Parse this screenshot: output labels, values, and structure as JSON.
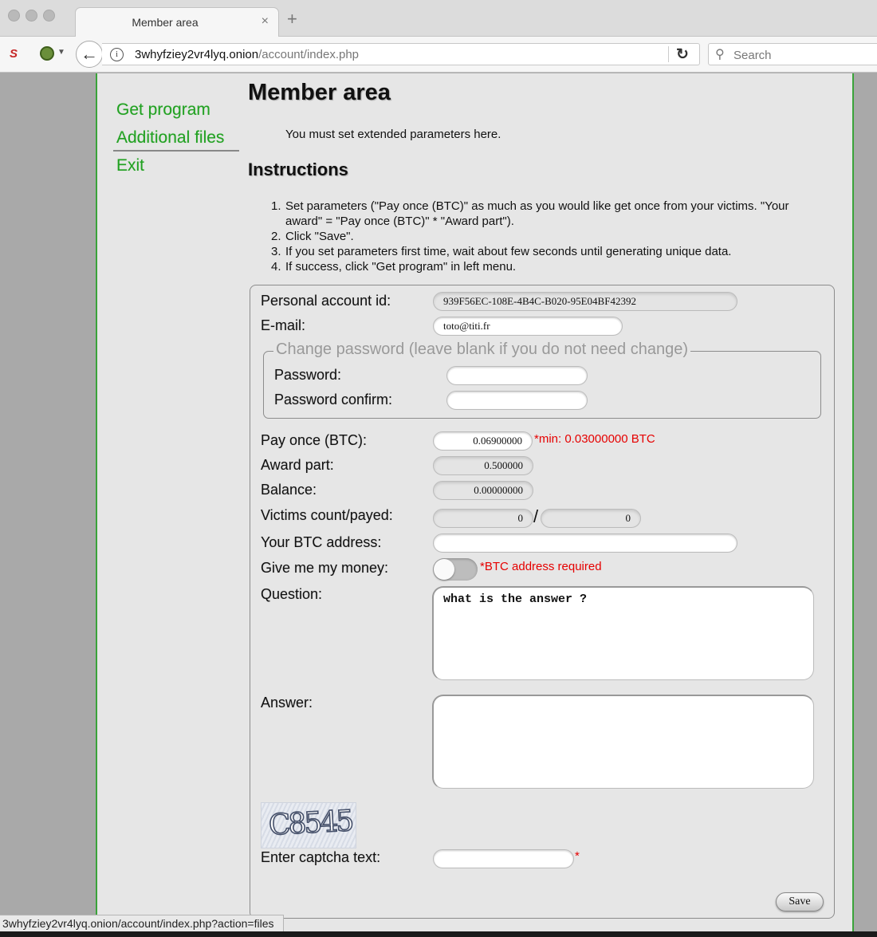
{
  "browser": {
    "tab_title": "Member area",
    "tab_close": "×",
    "new_tab": "+",
    "url_host": "3whyfziey2vr4lyq.onion",
    "url_path": "/account/index.php",
    "search_placeholder": "Search",
    "status_url": "3whyfziey2vr4lyq.onion/account/index.php?action=files"
  },
  "sidebar": {
    "items": [
      {
        "label": "Get program"
      },
      {
        "label": "Additional files"
      },
      {
        "label": "Exit"
      }
    ]
  },
  "main": {
    "title": "Member area",
    "notice": "You must set extended parameters here.",
    "instructions_title": "Instructions",
    "steps": [
      {
        "num": "1.",
        "text": "Set parameters (\"Pay once (BTC)\" as much as you would like get once from your victims. \"Your award\" = \"Pay once (BTC)\" * \"Award part\")."
      },
      {
        "num": "2.",
        "text": "Click \"Save\"."
      },
      {
        "num": "3.",
        "text": "If you set parameters first time, wait about few seconds until generating unique data."
      },
      {
        "num": "4.",
        "text": "If success, click \"Get program\" in left menu."
      }
    ]
  },
  "form": {
    "account_id_label": "Personal account id:",
    "account_id_value": "939F56EC-108E-4B4C-B020-95E04BF42392",
    "email_label": "E-mail:",
    "email_value": "toto@titi.fr",
    "password_legend": "Change password (leave blank if you do not need change)",
    "password_label": "Password:",
    "password_confirm_label": "Password confirm:",
    "pay_once_label": "Pay once (BTC):",
    "pay_once_value": "0.06900000",
    "pay_once_min": "*min: 0.03000000 BTC",
    "award_part_label": "Award part:",
    "award_part_value": "0.500000",
    "balance_label": "Balance:",
    "balance_value": "0.00000000",
    "victims_label": "Victims count/payed:",
    "victims_count": "0",
    "victims_separator": "/",
    "victims_payed": "0",
    "btc_address_label": "Your BTC address:",
    "btc_address_value": "",
    "give_money_label": "Give me my money:",
    "give_money_on": false,
    "btc_required": "*BTC address required",
    "question_label": "Question:",
    "question_value": "what is the answer ?",
    "answer_label": "Answer:",
    "answer_value": "",
    "captcha_image_text": "C8545",
    "captcha_label": "Enter captcha text:",
    "captcha_required": "*",
    "save_label": "Save"
  }
}
